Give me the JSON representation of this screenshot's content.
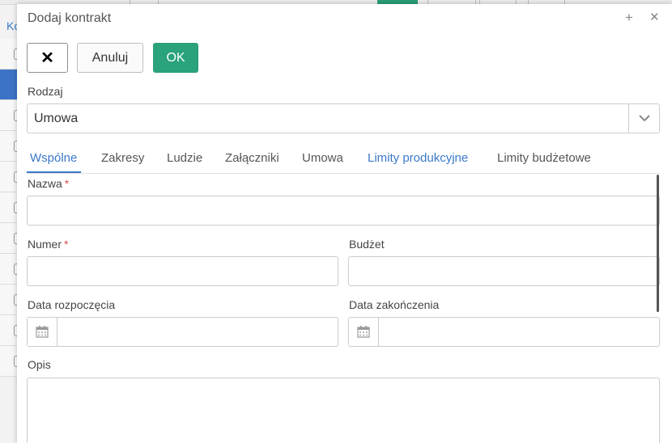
{
  "background": {
    "link_text": "Ko",
    "rows": [
      {
        "selected": false
      },
      {
        "selected": true
      },
      {
        "selected": false
      },
      {
        "selected": false
      },
      {
        "selected": false
      },
      {
        "selected": false
      },
      {
        "selected": false
      },
      {
        "selected": false
      },
      {
        "selected": false
      },
      {
        "selected": false
      },
      {
        "selected": false
      }
    ]
  },
  "modal": {
    "title": "Dodaj kontrakt",
    "header_icons": [
      "plus-icon",
      "close-icon"
    ],
    "toolbar": {
      "close_label": "✕",
      "cancel_label": "Anuluj",
      "ok_label": "OK"
    },
    "type_field": {
      "label": "Rodzaj",
      "value": "Umowa"
    },
    "tabs": [
      {
        "label": "Wspólne",
        "active": true
      },
      {
        "label": "Zakresy",
        "active": false
      },
      {
        "label": "Ludzie",
        "active": false
      },
      {
        "label": "Załączniki",
        "active": false
      },
      {
        "label": "Umowa",
        "active": false
      },
      {
        "label": "Limity produkcyjne",
        "active": false
      },
      {
        "label": "Limity budżetowe",
        "active": false
      }
    ],
    "form": {
      "name_label": "Nazwa",
      "name_value": "",
      "number_label": "Numer",
      "number_value": "",
      "budget_label": "Budżet",
      "budget_value": "",
      "start_date_label": "Data rozpoczęcia",
      "start_date_value": "",
      "end_date_label": "Data zakończenia",
      "end_date_value": "",
      "description_label": "Opis",
      "description_value": "",
      "required_marker": "*"
    },
    "colors": {
      "accent": "#3a78c9",
      "ok_button": "#2aa37c",
      "required": "#d9534f"
    }
  }
}
